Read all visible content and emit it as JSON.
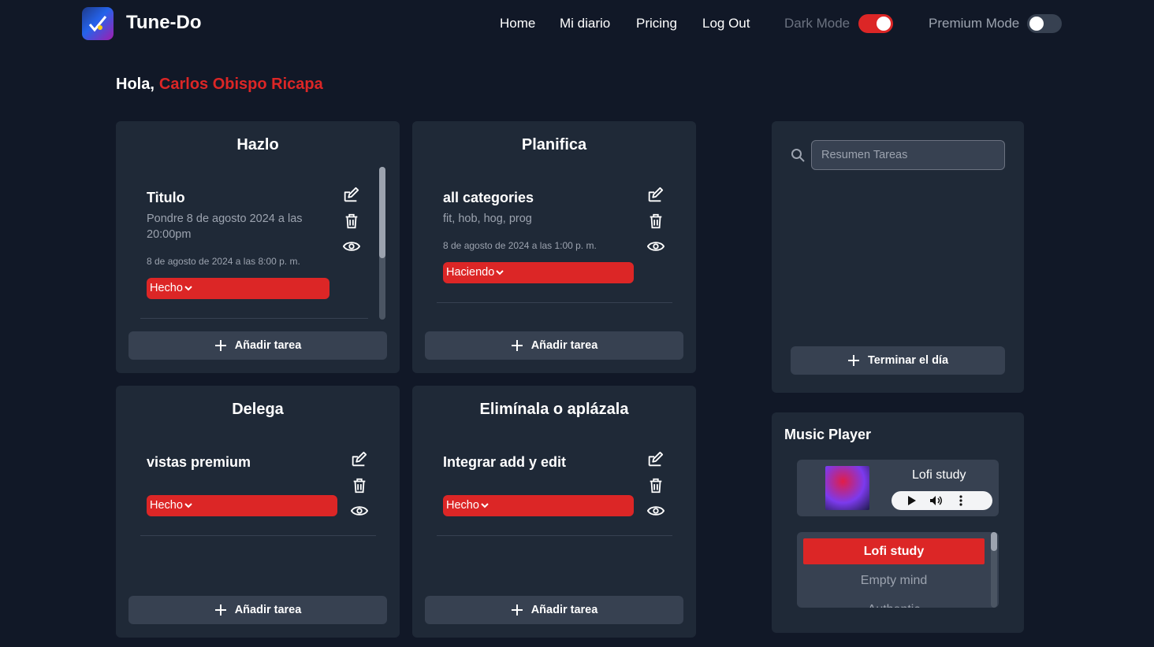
{
  "nav": {
    "brand": "Tune-Do",
    "links": [
      "Home",
      "Mi diario",
      "Pricing",
      "Log Out"
    ],
    "dark_mode_label": "Dark Mode",
    "dark_mode_on": true,
    "premium_mode_label": "Premium Mode",
    "premium_mode_on": false
  },
  "greeting": {
    "prefix": "Hola,",
    "name": "Carlos Obispo Ricapa"
  },
  "quadrants": {
    "hazlo": {
      "title": "Hazlo",
      "task": {
        "title": "Titulo",
        "desc": "Pondre 8 de agosto 2024 a las 20:00pm",
        "date": "8 de agosto de 2024 a las 8:00 p. m.",
        "status": "Hecho"
      },
      "add_label": "Añadir tarea"
    },
    "planifica": {
      "title": "Planifica",
      "task": {
        "title": "all categories",
        "desc": "fit, hob, hog, prog",
        "date": "8 de agosto de 2024 a las 1:00 p. m.",
        "status": "Haciendo"
      },
      "add_label": "Añadir tarea"
    },
    "delega": {
      "title": "Delega",
      "task": {
        "title": "vistas premium",
        "status": "Hecho"
      },
      "add_label": "Añadir tarea"
    },
    "elimina": {
      "title": "Elimínala o aplázala",
      "task": {
        "title": "Integrar add y edit",
        "status": "Hecho"
      },
      "add_label": "Añadir tarea"
    }
  },
  "summary": {
    "search_placeholder": "Resumen Tareas",
    "finish_label": "Terminar el día"
  },
  "music": {
    "title": "Music Player",
    "now_playing": "Lofi study",
    "playlist": [
      "Lofi study",
      "Empty mind",
      "Authentic"
    ]
  },
  "colors": {
    "accent": "#dc2626",
    "bg": "#111827",
    "card": "#1f2937"
  }
}
